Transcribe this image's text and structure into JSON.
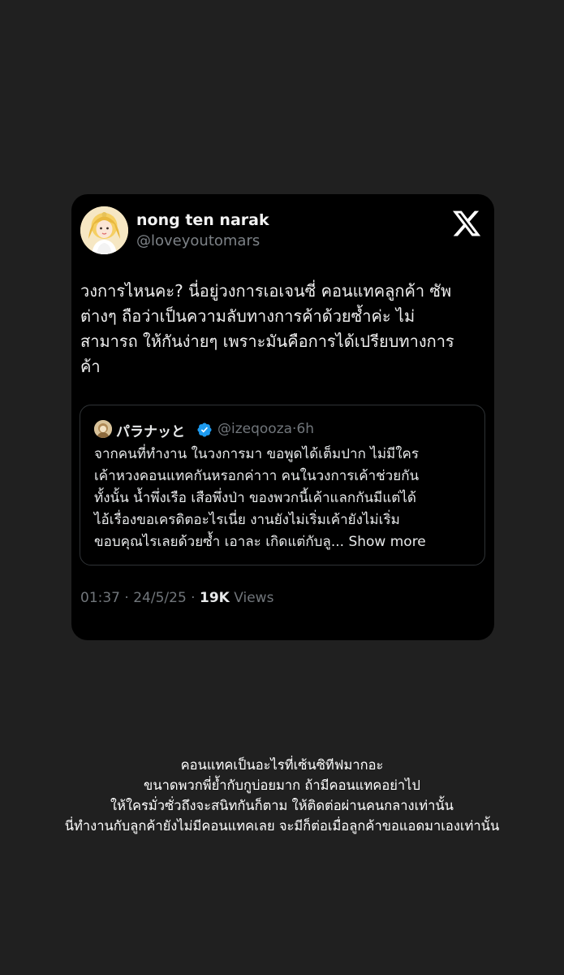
{
  "tweet": {
    "avatar": "avatar-cartoon-girl-icon",
    "display_name": "nong ten narak",
    "handle": "@loveyoutomars",
    "platform_icon": "x-logo-icon",
    "text_lines": [
      "วงการไหนคะ? นี่อยู่วงการเอเจนซี่ คอนแทคลูกค้า ซัพ",
      "ต่างๆ ถือว่าเป็นความลับทางการค้าด้วยซ้ำค่ะ ไม่",
      "สามารถ ให้กันง่ายๆ เพราะมันคือการได้เปรียบทางการ",
      "ค้า"
    ],
    "quote": {
      "avatar": "avatar-small-icon",
      "display_name": "パラナッと",
      "verified_icon": "verified-badge-icon",
      "handle": "@izeqooza",
      "separator": "·",
      "time": "6h",
      "text_lines": [
        "จากคนที่ทำงาน ในวงการมา ขอพูดได้เต็มปาก ไม่มีใคร",
        "เค้าหวงคอนแทคกันหรอกค่าาา คนในวงการเค้าช่วยกัน",
        "ทั้งนั้น น้ำพึ่งเรือ เสือพึ่งป่า ของพวกนี้เค้าแลกกันมีแต่ได้",
        "ไอ้เรื่องขอเครดิตอะไรเนี่ย งานยังไม่เริ่มเค้ายังไม่เริ่ม",
        "ขอบคุณไรเลยด้วยซ้ำ เอาละ เกิดแต่กับลู..."
      ],
      "show_more": "Show more"
    },
    "footer": {
      "time": "01:37",
      "date": "24/5/25",
      "separator": "·",
      "views_count": "19K",
      "views_label": "Views"
    }
  },
  "caption": {
    "lines": [
      "คอนแทคเป็นอะไรที่เซ้นซิทีฟมากอะ",
      "ขนาดพวกพี่ย้ำกับกูบ่อยมาก ถ้ามีคอนแทคอย่าไป",
      "ให้ใครมั่วซั่วถึงจะสนิทกันก็ตาม ให้ติดต่อผ่านคนกลางเท่านั้น",
      "นี่ทำงานกับลูกค้ายังไม่มีคอนแทคเลย จะมีก็ต่อเมื่อลูกค้าขอแอดมาเองเท่านั้น"
    ]
  },
  "colors": {
    "background": "#202020",
    "card": "#000000",
    "secondary_text": "#71767b",
    "verified_blue": "#1d9bf0"
  }
}
